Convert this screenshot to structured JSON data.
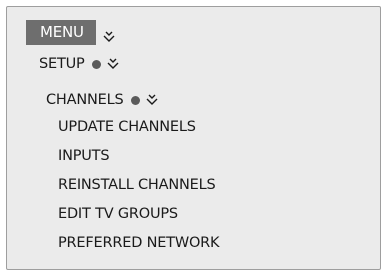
{
  "menu": {
    "title": "MENU",
    "path": [
      {
        "label": "SETUP"
      },
      {
        "label": "CHANNELS"
      }
    ],
    "items": [
      {
        "label": "UPDATE CHANNELS"
      },
      {
        "label": "INPUTS"
      },
      {
        "label": "REINSTALL CHANNELS"
      },
      {
        "label": "EDIT TV GROUPS"
      },
      {
        "label": "PREFERRED NETWORK"
      }
    ]
  },
  "icons": {
    "selected_marker": "dot-icon",
    "submenu_indicator": "chevron-down-icon"
  },
  "colors": {
    "panel_background": "#ebebeb",
    "panel_border": "#9e9e9e",
    "menu_highlight": "#6e6e6e",
    "text": "#1a1a1a",
    "highlight_text": "#ffffff"
  }
}
